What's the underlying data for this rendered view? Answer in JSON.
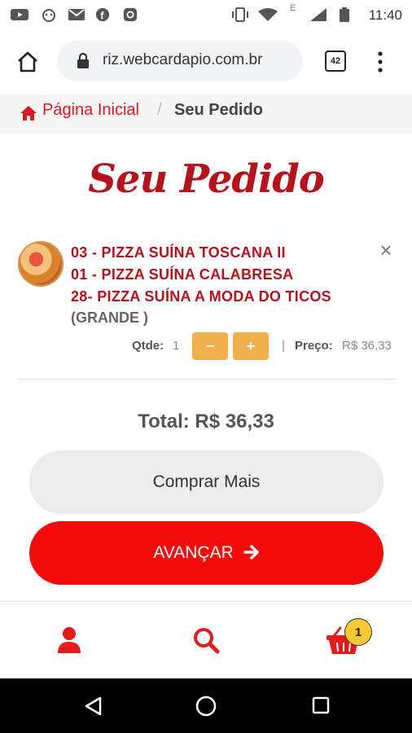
{
  "status_bar": {
    "time": "11:40",
    "icons": [
      "youtube-icon",
      "cat-icon",
      "gmail-icon",
      "facebook-icon",
      "instagram-icon",
      "vibrate-icon",
      "wifi-icon",
      "signal-icon",
      "battery-icon"
    ],
    "network_letter": "E"
  },
  "browser": {
    "url": "riz.webcardapio.com.br",
    "tab_count": "42",
    "icons": [
      "home-icon",
      "lock-icon",
      "menu-dots-icon"
    ]
  },
  "breadcrumb": {
    "home_label": "Página Inicial",
    "separator": "/",
    "current": "Seu Pedido"
  },
  "page": {
    "title": "Seu Pedido"
  },
  "order_item": {
    "lines": [
      "03 - PIZZA SUÍNA TOSCANA II",
      "01 - PIZZA SUÍNA CALABRESA",
      "28- PIZZA SUÍNA A MODA DO TICOS"
    ],
    "size": "(GRANDE )",
    "qty_label": "Qtde:",
    "qty_value": "1",
    "minus_label": "−",
    "plus_label": "+",
    "separator": "|",
    "price_label": "Preço:",
    "price_value": "R$ 36,33"
  },
  "summary": {
    "total": "Total: R$ 36,33"
  },
  "actions": {
    "buy_more": "Comprar Mais",
    "advance": "AVANÇAR"
  },
  "bottom_nav": {
    "cart_count": "1",
    "icons": [
      "user-icon",
      "search-icon",
      "cart-icon"
    ]
  },
  "colors": {
    "brand_red": "#d71920",
    "title_red": "#b5121b",
    "button_red": "#f20c0c",
    "qty_orange": "#f0b04d",
    "badge_yellow": "#f7c932"
  }
}
